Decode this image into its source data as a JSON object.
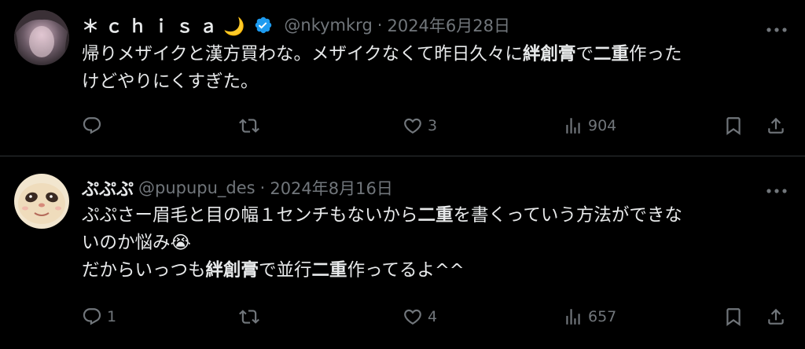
{
  "tweets": [
    {
      "display_name": "＊ｃｈｉｓａ🌙",
      "verified": true,
      "handle": "@nkymkrg",
      "separator": "·",
      "date": "2024年6月28日",
      "text": [
        {
          "t": "帰りメザイクと漢方買わな。メザイクなくて昨日久々に",
          "b": false
        },
        {
          "t": "絆創膏",
          "b": true
        },
        {
          "t": "で",
          "b": false
        },
        {
          "t": "二重",
          "b": true
        },
        {
          "t": "作った\nけどやりにくすぎた。",
          "b": false
        }
      ],
      "reply_count": "",
      "retweet_count": "",
      "like_count": "3",
      "view_count": "904"
    },
    {
      "display_name": "ぷぷぷ",
      "verified": false,
      "handle": "@pupupu_des",
      "separator": "·",
      "date": "2024年8月16日",
      "text": [
        {
          "t": "ぷぷさー眉毛と目の幅１センチもないから",
          "b": false
        },
        {
          "t": "二重",
          "b": true
        },
        {
          "t": "を書くっていう方法ができな\nいのか悩み😭\nだからいっつも",
          "b": false
        },
        {
          "t": "絆創膏",
          "b": true
        },
        {
          "t": "で並行",
          "b": false
        },
        {
          "t": "二重",
          "b": true
        },
        {
          "t": "作ってるよ^^",
          "b": false
        }
      ],
      "reply_count": "1",
      "retweet_count": "",
      "like_count": "4",
      "view_count": "657"
    }
  ],
  "icons": {
    "verified": "verified-badge-icon",
    "more": "more-dots-icon",
    "reply": "reply-icon",
    "retweet": "retweet-icon",
    "like": "heart-icon",
    "views": "views-chart-icon",
    "bookmark": "bookmark-icon",
    "share": "share-icon"
  },
  "colors": {
    "background": "#000000",
    "text": "#e7e9ea",
    "muted": "#71767b",
    "divider": "#2f3336",
    "verified": "#1d9bf0"
  }
}
